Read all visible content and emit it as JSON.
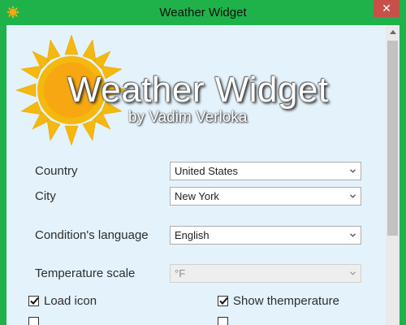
{
  "window": {
    "title": "Weather Widget",
    "close_glyph": "✕"
  },
  "logo": {
    "title": "Weather Widget",
    "subtitle": "by Vadim Verloka"
  },
  "form": {
    "country": {
      "label": "Country",
      "value": "United States"
    },
    "city": {
      "label": "City",
      "value": "New York"
    },
    "language": {
      "label": "Condition's language",
      "value": "English"
    },
    "temp_scale": {
      "label": "Temperature scale",
      "value": "°F",
      "disabled": true
    }
  },
  "options": {
    "load_icon": {
      "label": "Load icon",
      "checked": true
    },
    "show_temperature": {
      "label": "Show themperature",
      "checked": true
    }
  },
  "icons": {
    "app": "sun-icon",
    "close": "close-icon",
    "dropdown": "chevron-down-icon",
    "check": "checkmark-icon"
  },
  "colors": {
    "titlebar": "#1fb24a",
    "client_bg": "#e4f2fb",
    "close": "#c7504a",
    "sun": "#f5b80e"
  }
}
